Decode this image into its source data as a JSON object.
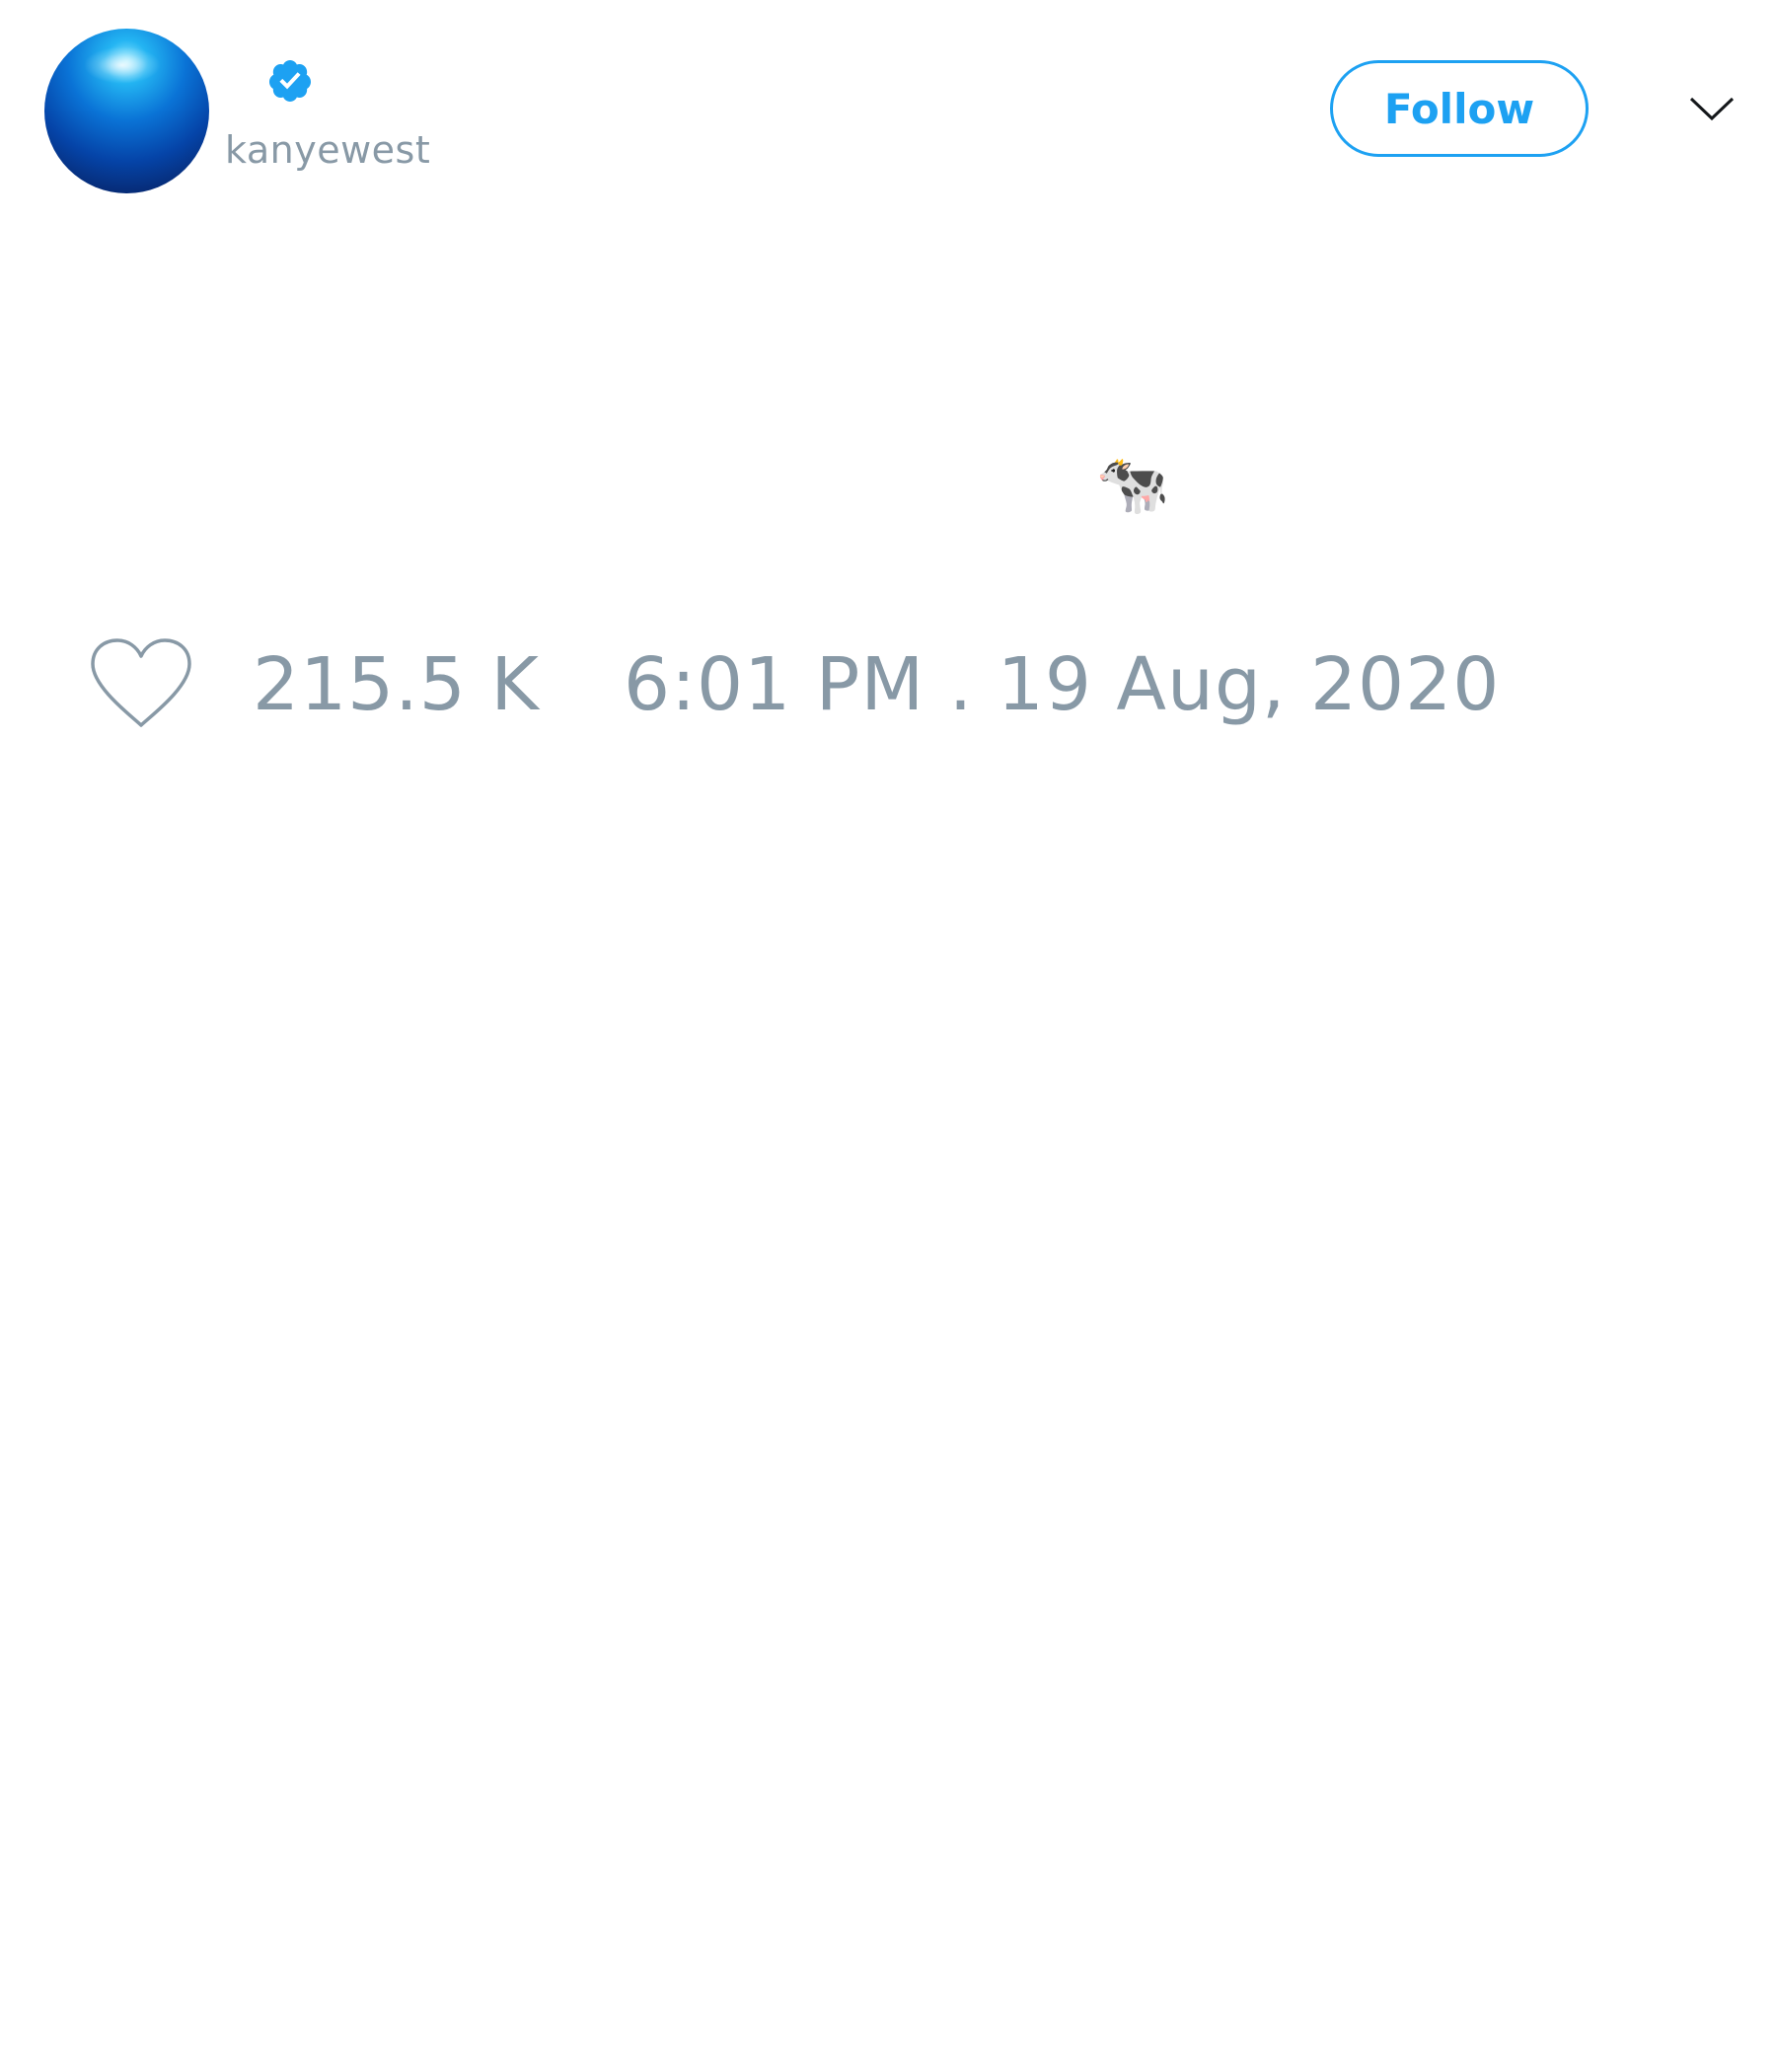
{
  "header": {
    "username": "kanyewest",
    "verified": true,
    "follow_label": "Follow",
    "accent_color": "#1da1f2"
  },
  "tweet": {
    "text": "🐄"
  },
  "footer": {
    "like_count": "215.5 K",
    "timestamp": "6:01 PM . 19 Aug, 2020",
    "muted_color": "#8899a6"
  },
  "icons": [
    "avatar",
    "verified-badge-icon",
    "chevron-down-icon",
    "heart-icon"
  ]
}
